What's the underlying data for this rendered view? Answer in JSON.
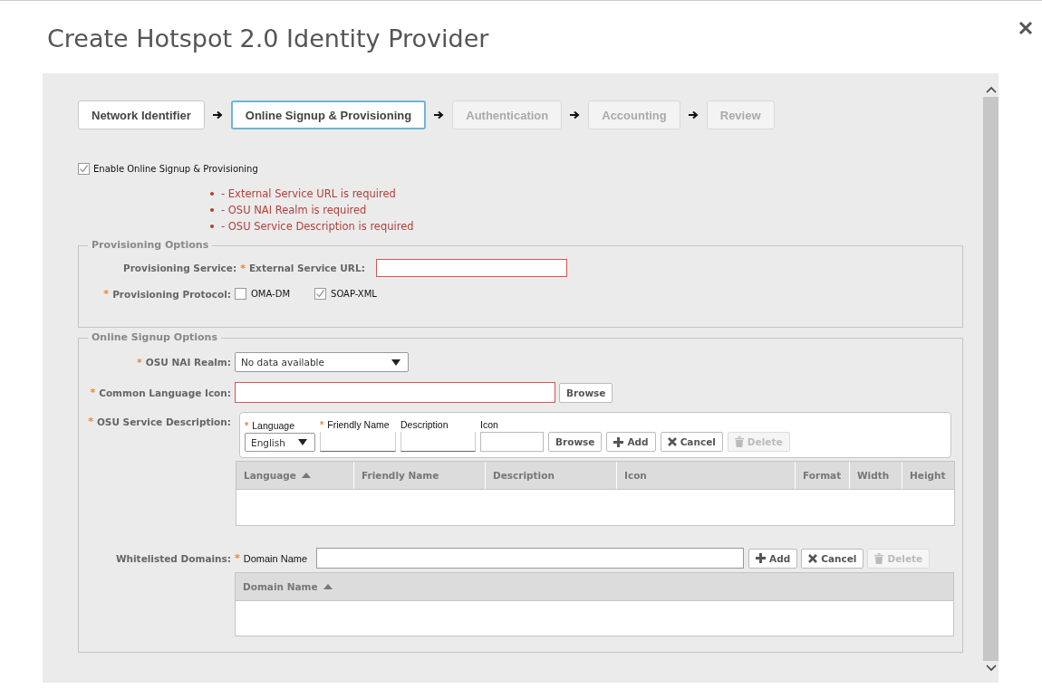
{
  "dialog": {
    "title": "Create Hotspot 2.0 Identity Provider"
  },
  "steps": [
    {
      "label": "Network Identifier",
      "selected": false,
      "disabled": false
    },
    {
      "label": "Online Signup & Provisioning",
      "selected": true,
      "disabled": false
    },
    {
      "label": "Authentication",
      "selected": false,
      "disabled": true
    },
    {
      "label": "Accounting",
      "selected": false,
      "disabled": true
    },
    {
      "label": "Review",
      "selected": false,
      "disabled": true
    }
  ],
  "enable_osu": {
    "label": "Enable Online Signup & Provisioning",
    "checked": true
  },
  "errors": [
    "- External Service URL is required",
    "- OSU NAI Realm is required",
    "- OSU Service Description is required"
  ],
  "provisioning_options": {
    "legend": "Provisioning Options",
    "service_label": "Provisioning Service:",
    "url_label": {
      "mark": "*",
      "text": "External Service URL:"
    },
    "url_invalid": true,
    "protocol_label": {
      "mark": "*",
      "text": "Provisioning Protocol:"
    },
    "protocols": [
      {
        "label": "OMA-DM",
        "checked": false
      },
      {
        "label": "SOAP-XML",
        "checked": true
      }
    ]
  },
  "online_signup_options": {
    "legend": "Online Signup Options",
    "realm": {
      "mark": "*",
      "label": "OSU NAI Realm:",
      "value": "No data available"
    },
    "language_icon": {
      "mark": "*",
      "label": "Common Language Icon:",
      "invalid": true,
      "button": "Browse"
    },
    "service_description": {
      "mark": "*",
      "label": "OSU Service Description:",
      "fields": [
        {
          "kind": "select",
          "mark": "*",
          "label": "Language",
          "value": "English"
        },
        {
          "kind": "input",
          "mark": "*",
          "label": "Friendly Name"
        },
        {
          "kind": "input",
          "label": "Description"
        },
        {
          "kind": "input",
          "label": "Icon"
        }
      ],
      "buttons": [
        {
          "label": "Browse",
          "kind": "browse",
          "disabled": false
        },
        {
          "label": "Add",
          "kind": "add",
          "disabled": false
        },
        {
          "label": "Cancel",
          "kind": "cancel",
          "disabled": false
        },
        {
          "label": "Delete",
          "kind": "delete",
          "disabled": true
        }
      ],
      "columns": [
        {
          "label": "Language",
          "sorted": true
        },
        {
          "label": "Friendly Name",
          "sorted": false
        },
        {
          "label": "Description",
          "sorted": false
        },
        {
          "label": "Icon",
          "sorted": false
        },
        {
          "label": "Format",
          "sorted": false
        },
        {
          "label": "Width",
          "sorted": false
        },
        {
          "label": "Height",
          "sorted": false
        }
      ]
    },
    "whitelisted_domains": {
      "label": "Whitelisted Domains:",
      "field": {
        "mark": "*",
        "label": "Domain Name"
      },
      "buttons": [
        {
          "label": "Add",
          "kind": "add",
          "disabled": false
        },
        {
          "label": "Cancel",
          "kind": "cancel",
          "disabled": false
        },
        {
          "label": "Delete",
          "kind": "delete",
          "disabled": true
        }
      ],
      "columns": [
        {
          "label": "Domain Name",
          "sorted": true
        }
      ]
    }
  }
}
